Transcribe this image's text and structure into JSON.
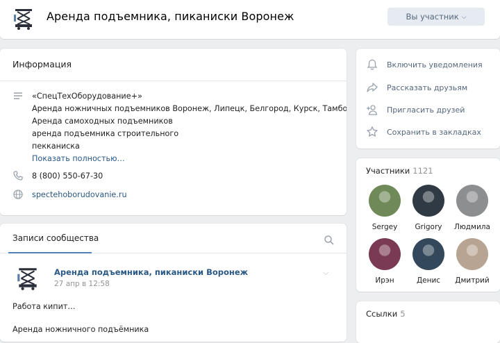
{
  "header": {
    "title": "Аренда подъемника, пиканиски Воронеж",
    "member_button": "Вы участник"
  },
  "info": {
    "title": "Информация",
    "description_lines": [
      "«СпецТехОборудование+»",
      "Аренда ножничных подъемников Воронеж, Липецк, Белгород, Курск, Тамбов.",
      "Аренда самоходных подъемников",
      "аренда подъемника строительного",
      "пекканиска"
    ],
    "show_more": "Показать полностью…",
    "phone": "8 (800) 550-67-30",
    "website": "spectehoborudovanie.ru"
  },
  "posts": {
    "tab_label": "Записи сообщества",
    "post": {
      "author": "Аренда подъемника, пиканиски Воронеж",
      "date": "27 апр в 12:58",
      "text_line1": "Работа кипит…",
      "text_line2": "Аренда ножничного подъёмника"
    }
  },
  "actions": [
    {
      "label": "Включить уведомления",
      "icon": "bell-icon"
    },
    {
      "label": "Рассказать друзьям",
      "icon": "share-icon"
    },
    {
      "label": "Пригласить друзей",
      "icon": "add-user-icon"
    },
    {
      "label": "Сохранить в закладках",
      "icon": "star-icon"
    }
  ],
  "members": {
    "title": "Участники",
    "count": "1121",
    "list": [
      {
        "name": "Sergey",
        "color": "#6f8a58"
      },
      {
        "name": "Grigory",
        "color": "#2f3a44"
      },
      {
        "name": "Людмила",
        "color": "#8d8e90"
      },
      {
        "name": "Ирэн",
        "color": "#7b3a54"
      },
      {
        "name": "Денис",
        "color": "#33485a"
      },
      {
        "name": "Дмитрий",
        "color": "#b8a493"
      }
    ]
  },
  "links": {
    "title": "Ссылки",
    "count": "5"
  },
  "colors": {
    "link": "#2a5885",
    "background": "#edeef0",
    "button_bg": "#e5ebf1",
    "muted": "#939393"
  }
}
